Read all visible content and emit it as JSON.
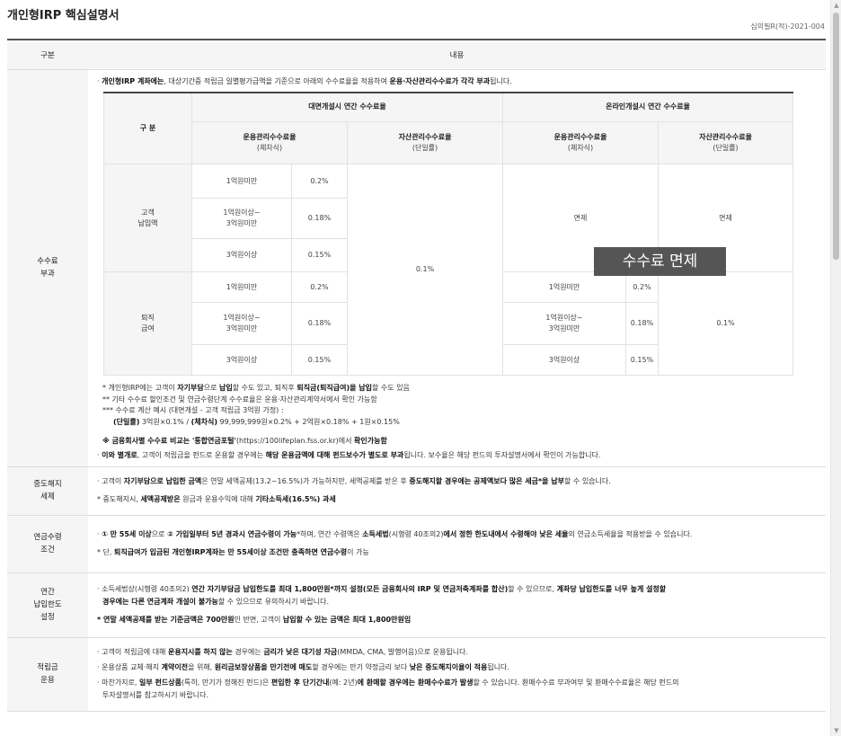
{
  "page": {
    "title": "개인형IRP 핵심설명서",
    "doc_no": "심의필R(적)-2021-004"
  },
  "header": {
    "col1": "구분",
    "col2": "내용"
  },
  "fee": {
    "label": "수수료\n부과",
    "intro_a": "개인형IRP 계좌에는",
    "intro_b": ", 대상기간중 적립금 일별평가금액을 기준으로 아래의 수수료율을 적용하여 ",
    "intro_c": "운용·자산관리수수료가 각각 부과",
    "intro_d": "됩니다.",
    "table": {
      "gubun": "구 분",
      "offline": "대면개설시 연간 수수료율",
      "online": "온라인개설시 연간 수수료율",
      "op_fee": "운용관리수수료율",
      "op_sub": "(체차식)",
      "asset_fee": "자산관리수수료율",
      "asset_sub": "(단일률)",
      "cust": "고객\n납입액",
      "retire": "퇴직\n급여",
      "t1": "1억원미만",
      "t2": "1억원이상~\n3억원미만",
      "t3": "3억원이상",
      "r1": "0.2%",
      "r2": "0.18%",
      "r3": "0.15%",
      "asset_rate": "0.1%",
      "exempt": "면제",
      "online_asset_retire": "0.1%"
    },
    "overlay": "수수료 면제",
    "note1a": "* 개인형IRP에는 고객이 ",
    "note1b": "자기부담",
    "note1c": "으로 ",
    "note1d": "납입",
    "note1e": "할 수도 있고, 퇴직후 ",
    "note1f": "퇴직금(퇴직급여)을 납입",
    "note1g": "할 수도 있음",
    "note2": "** 기타 수수료 할인조건 및 연금수령단계 수수료율은 운용·자산관리계약서에서 확인 가능함",
    "note3": "*** 수수료 계산 예시 (대면개설 - 고객 적립금 3억원 가정) :",
    "note4a": "(단일률)",
    "note4b": " 3억원×0.1% / ",
    "note4c": "(체차식)",
    "note4d": " 99,999,999원×0.2% + 2억원×0.18% + 1원×0.15%",
    "compare_a": "※ 금융회사별 수수료 비교는 '통합연금포털'",
    "compare_b": "(https://100lifeplan.fss.or.kr)",
    "compare_c": "에서 ",
    "compare_d": "확인가능함",
    "extra_a": "이와 별개로",
    "extra_b": ", 고객이 적립금을 펀드로 운용할 경우에는 ",
    "extra_c": "해당 운용금액에 대해 펀드보수가 별도로 부과",
    "extra_d": "됩니다. 보수율은 해당 펀드의 투자설명서에서 확인이 가능합니다."
  },
  "midterm": {
    "label": "중도해지\n세제",
    "l1a": "고객이 ",
    "l1b": "자기부담으로 납입한 금액",
    "l1c": "은 연말 세액공제(13.2~16.5%)가 가능하지만, 세액공제를 받은 후 ",
    "l1d": "중도해지할 경우에는 공제액보다 많은 세금",
    "l1e": "*을 납부",
    "l1f": "할 수 있습니다.",
    "l2a": "* 중도해지시, ",
    "l2b": "세액공제받은",
    "l2c": " 원금과 운용수익에 대해 ",
    "l2d": "기타소득세(16.5%) 과세"
  },
  "pension": {
    "label": "연금수령\n조건",
    "l1a": "① 만 55세 이상",
    "l1b": "으로 ",
    "l1c": "② 가입일부터 5년 경과시 연금수령이 가능",
    "l1d": "*하며, 연간 수령액은 ",
    "l1e": "소득세법",
    "l1f": "(시행령 40조의2)",
    "l1g": "에서 정한 한도내에서 수령해야 낮은 세율",
    "l1h": "의 연금소득세율을 적용받을 수 있습니다.",
    "l2a": "* 단, ",
    "l2b": "퇴직급여가 입금된 개인형IRP계좌는 만 55세이상 조건만 충족하면 연금수령",
    "l2c": "이 가능"
  },
  "limit": {
    "label": "연간\n납입한도\n설정",
    "l1a": "소득세법상(시행령 40조의2) ",
    "l1b": "연간 자기부담금 납입한도를 최대 1,800만원",
    "l1c": "*까지 설정(모든 금융회사의 IRP 및 연금저축계좌를 합산)",
    "l1d": "할 수 있으므로, ",
    "l1e": "계좌당 납입한도를 너무 높게 설정할",
    "l1f": "경우에는 다른 연금계좌 개설이 불가능",
    "l1g": "할 수 있으므로 유의하시기 바랍니다.",
    "l2a": "* 연말 세액공제를 받는 기준금액은 700만원",
    "l2b": "인 반면, 고객이 ",
    "l2c": "납입할 수 있는 금액은 최대 1,800만원임"
  },
  "reserve": {
    "label": "적립금\n운용",
    "l1a": "고객이 적립금에 대해 ",
    "l1b": "운용지시를 하지 않는",
    "l1c": " 경우에는 ",
    "l1d": "금리가 낮은 대기성 자금",
    "l1e": "(MMDA, CMA, 발행어음)으로 운용됩니다.",
    "l2a": "운용상품 교체·해지 ",
    "l2b": "계약이전",
    "l2c": "을 위해, ",
    "l2d": "원리금보장상품을 만기전에 매도",
    "l2e": "할 경우에는 만기 약정금리 보다 ",
    "l2f": "낮은 중도해지이율이 적용",
    "l2g": "됩니다.",
    "l3a": "마찬가지로, ",
    "l3b": "일부 펀드상품",
    "l3c": "(특히, 만기가 정해진 펀드)은 ",
    "l3d": "편입한 후 단기간내",
    "l3e": "(예: 2년)",
    "l3f": "에 환매할 경우에는 환매수수료가 발생",
    "l3g": "할 수 있습니다. 환매수수료 부과여부 및 환매수수료율은 해당 펀드의",
    "l3h": "투자설명서를 참고하시기 바랍니다."
  }
}
